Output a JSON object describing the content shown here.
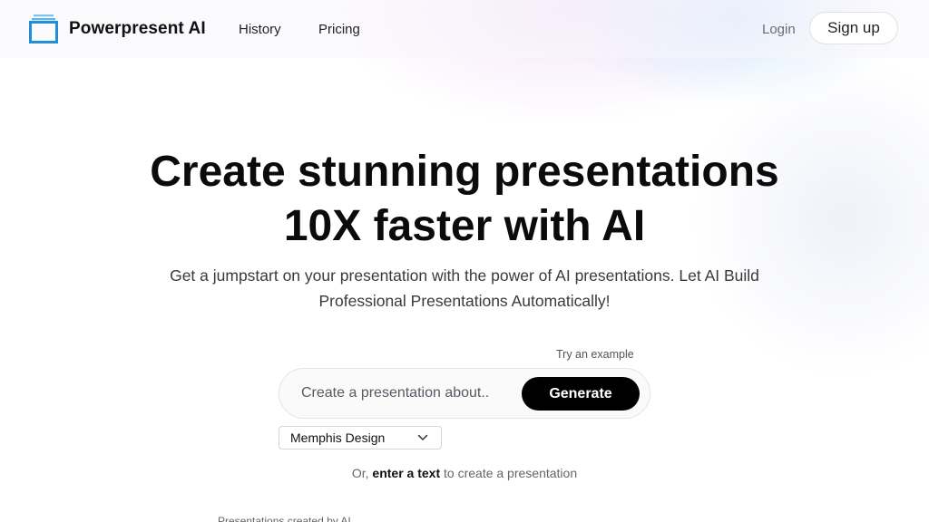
{
  "header": {
    "brand": "Powerpresent AI",
    "nav": [
      {
        "label": "History"
      },
      {
        "label": "Pricing"
      }
    ],
    "login_label": "Login",
    "signup_label": "Sign up"
  },
  "hero": {
    "title_line1": "Create stunning presentations",
    "title_line2": "10X faster with AI",
    "subtitle": "Get a jumpstart on your presentation with the power of AI presentations. Let AI Build Professional Presentations Automatically!"
  },
  "generator": {
    "try_example": "Try an example",
    "prompt_placeholder": "Create a presentation about..",
    "prompt_value": "",
    "generate_label": "Generate",
    "theme_selected": "Memphis Design",
    "or_prefix": "Or,",
    "or_link": "enter a text",
    "or_suffix": "to create a presentation"
  },
  "footer_partial": {
    "cut_text": "Presentations created by AI"
  },
  "colors": {
    "primary_button": "#000000",
    "logo_accent": "#1f8fd6",
    "logo_light": "#7cc4ee"
  },
  "icons": {
    "logo": "stacked-window-logo-icon",
    "select_arrow": "chevron-down-icon"
  }
}
